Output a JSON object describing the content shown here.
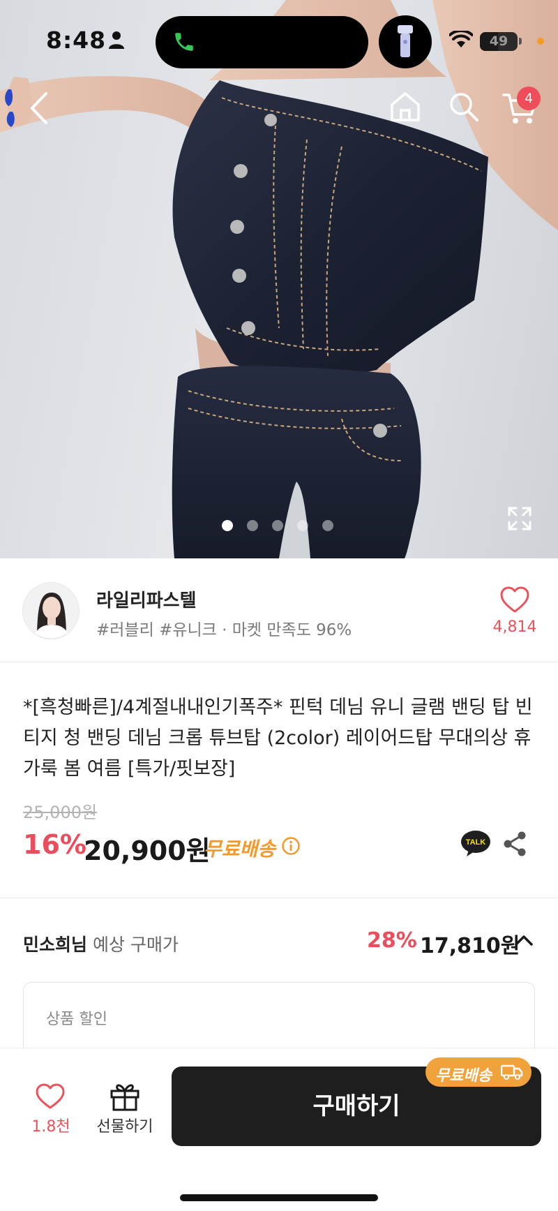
{
  "status_bar": {
    "time": "8:48",
    "battery": "49"
  },
  "nav": {
    "cart_count": "4"
  },
  "gallery": {
    "total_images": 5,
    "active_index": 0
  },
  "store": {
    "name": "라일리파스텔",
    "tags": "#러블리 #유니크 · 마켓 만족도 96%",
    "likes": "4,814"
  },
  "product": {
    "title": "*[흑청빠른]/4계절내내인기폭주* 핀턱 데님 유니 글램 밴딩 탑 빈티지 청 밴딩 데님 크롭 튜브탑 (2color) 레이어드탑 무대의상 휴가룩 봄 여름 [특가/핏보장]",
    "original_price": "25,000원",
    "discount": "16%",
    "price": "20,900원",
    "shipping": "무료배송",
    "talk_label": "TALK"
  },
  "member_price": {
    "name": "민소희님",
    "label": "예상 구매가",
    "discount": "28%",
    "price": "17,810원"
  },
  "discount_detail": {
    "title": "상품 할인"
  },
  "bottom_bar": {
    "wish_count": "1.8천",
    "gift_label": "선물하기",
    "buy_label": "구매하기",
    "shipping_chip": "무료배송"
  },
  "colors": {
    "accent_red": "#ea4d5b",
    "shipping_orange": "#f29a2e",
    "buy_button": "#1e1e1e"
  }
}
